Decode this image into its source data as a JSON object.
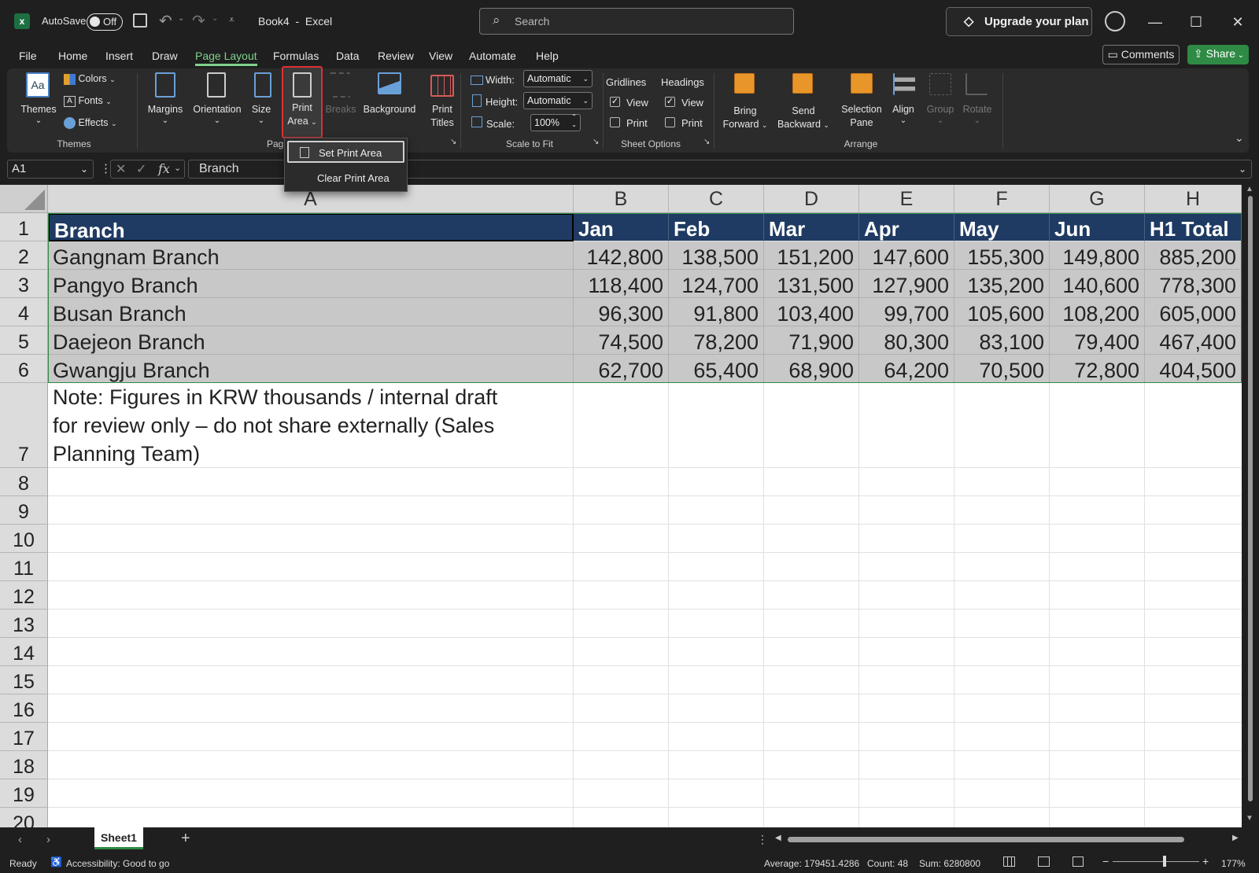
{
  "titlebar": {
    "autosave_label": "AutoSave",
    "autosave_state": "Off",
    "doc_title": "Book4  -  Excel",
    "search_placeholder": "Search",
    "upgrade_label": "Upgrade your plan"
  },
  "menu": {
    "tabs": [
      "File",
      "Home",
      "Insert",
      "Draw",
      "Page Layout",
      "Formulas",
      "Data",
      "Review",
      "View",
      "Automate",
      "Help"
    ],
    "active": "Page Layout",
    "comments_label": "Comments",
    "share_label": "Share"
  },
  "ribbon": {
    "themes": {
      "themes_label": "Themes",
      "colors_label": "Colors",
      "fonts_label": "Fonts",
      "effects_label": "Effects",
      "group_label": "Themes"
    },
    "page_setup": {
      "margins": "Margins",
      "orientation": "Orientation",
      "size": "Size",
      "print_area_1": "Print",
      "print_area_2": "Area",
      "breaks": "Breaks",
      "background": "Background",
      "print_titles_1": "Print",
      "print_titles_2": "Titles",
      "group_label": "Pag"
    },
    "scale": {
      "width_label": "Width:",
      "width_value": "Automatic",
      "height_label": "Height:",
      "height_value": "Automatic",
      "scale_label": "Scale:",
      "scale_value": "100%",
      "group_label": "Scale to Fit"
    },
    "sheet_options": {
      "gridlines": "Gridlines",
      "headings": "Headings",
      "view": "View",
      "print": "Print",
      "group_label": "Sheet Options"
    },
    "arrange": {
      "bring_1": "Bring",
      "bring_2": "Forward",
      "send_1": "Send",
      "send_2": "Backward",
      "sel_1": "Selection",
      "sel_2": "Pane",
      "align": "Align",
      "group": "Group",
      "rotate": "Rotate",
      "group_label": "Arrange"
    }
  },
  "print_area_menu": {
    "set": "Set Print Area",
    "clear": "Clear Print Area"
  },
  "formula_bar": {
    "name_box": "A1",
    "fx": "fx",
    "content": "Branch"
  },
  "columns": [
    "A",
    "B",
    "C",
    "D",
    "E",
    "F",
    "G",
    "H"
  ],
  "rows": [
    "1",
    "2",
    "3",
    "4",
    "5",
    "6",
    "7",
    "8",
    "9",
    "10",
    "11",
    "12",
    "13",
    "14",
    "15",
    "16",
    "17",
    "18",
    "19",
    "20"
  ],
  "table": {
    "header": [
      "Branch",
      "Jan",
      "Feb",
      "Mar",
      "Apr",
      "May",
      "Jun",
      "H1 Total"
    ],
    "data": [
      [
        "Gangnam Branch",
        "142,800",
        "138,500",
        "151,200",
        "147,600",
        "155,300",
        "149,800",
        "885,200"
      ],
      [
        "Pangyo Branch",
        "118,400",
        "124,700",
        "131,500",
        "127,900",
        "135,200",
        "140,600",
        "778,300"
      ],
      [
        "Busan Branch",
        "96,300",
        "91,800",
        "103,400",
        "99,700",
        "105,600",
        "108,200",
        "605,000"
      ],
      [
        "Daejeon Branch",
        "74,500",
        "78,200",
        "71,900",
        "80,300",
        "83,100",
        "79,400",
        "467,400"
      ],
      [
        "Gwangju Branch",
        "62,700",
        "65,400",
        "68,900",
        "64,200",
        "70,500",
        "72,800",
        "404,500"
      ]
    ],
    "note_line1": "Note: Figures in KRW thousands / internal draft",
    "note_line2": "for review only – do not share externally (Sales",
    "note_line3": "Planning Team)"
  },
  "sheets": {
    "active": "Sheet1"
  },
  "status": {
    "ready": "Ready",
    "accessibility": "Accessibility: Good to go",
    "average": "Average: 179451.4286",
    "count": "Count: 48",
    "sum": "Sum: 6280800",
    "zoom": "177%"
  },
  "colors": {
    "accent_green": "#7fd18b",
    "share_green": "#2e8a44",
    "header_fill": "#1f3b63",
    "data_fill": "#c8c8c8",
    "highlight_red": "#e03030"
  }
}
